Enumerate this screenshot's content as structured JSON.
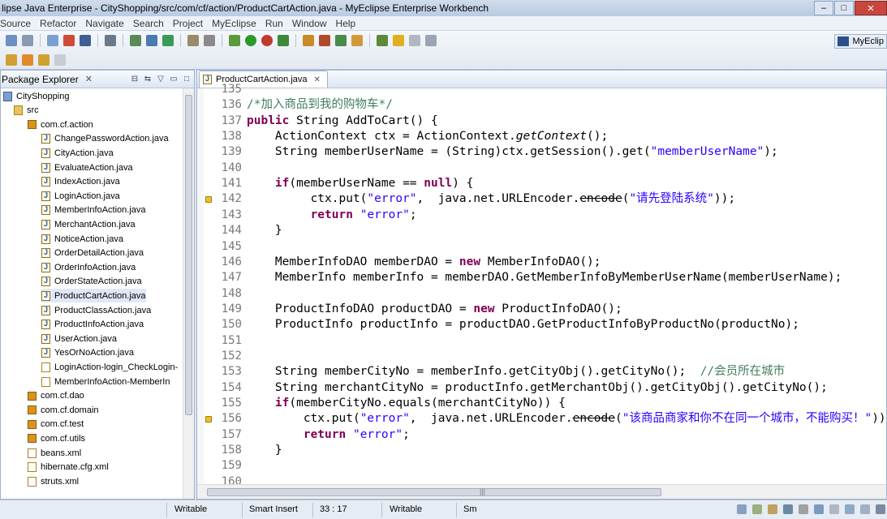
{
  "window": {
    "title": "lipse Java Enterprise - CityShopping/src/com/cf/action/ProductCartAction.java - MyEclipse Enterprise Workbench"
  },
  "menu": [
    "Source",
    "Refactor",
    "Navigate",
    "Search",
    "Project",
    "MyEclipse",
    "Run",
    "Window",
    "Help"
  ],
  "perspective": {
    "label": "MyEclip"
  },
  "package_explorer": {
    "title": "Package Explorer",
    "close": "✕",
    "tree": [
      {
        "label": "CityShopping",
        "icon": "project-icon"
      },
      {
        "label": "src",
        "icon": "source-folder-icon"
      },
      {
        "label": "com.cf.action",
        "icon": "package-icon"
      },
      {
        "label": "ChangePasswordAction.java",
        "icon": "java-file-icon"
      },
      {
        "label": "CityAction.java",
        "icon": "java-file-icon"
      },
      {
        "label": "EvaluateAction.java",
        "icon": "java-file-icon"
      },
      {
        "label": "IndexAction.java",
        "icon": "java-file-icon"
      },
      {
        "label": "LoginAction.java",
        "icon": "java-file-icon"
      },
      {
        "label": "MemberInfoAction.java",
        "icon": "java-file-icon"
      },
      {
        "label": "MerchantAction.java",
        "icon": "java-file-icon"
      },
      {
        "label": "NoticeAction.java",
        "icon": "java-file-icon"
      },
      {
        "label": "OrderDetailAction.java",
        "icon": "java-file-icon"
      },
      {
        "label": "OrderInfoAction.java",
        "icon": "java-file-icon"
      },
      {
        "label": "OrderStateAction.java",
        "icon": "java-file-icon"
      },
      {
        "label": "ProductCartAction.java",
        "icon": "java-file-icon"
      },
      {
        "label": "ProductClassAction.java",
        "icon": "java-file-icon"
      },
      {
        "label": "ProductInfoAction.java",
        "icon": "java-file-icon"
      },
      {
        "label": "UserAction.java",
        "icon": "java-file-icon"
      },
      {
        "label": "YesOrNoAction.java",
        "icon": "java-file-icon"
      },
      {
        "label": "LoginAction-login_CheckLogin-",
        "icon": "xml-file-icon"
      },
      {
        "label": "MemberInfoAction-MemberIn",
        "icon": "xml-file-icon"
      },
      {
        "label": "com.cf.dao",
        "icon": "package-icon"
      },
      {
        "label": "com.cf.domain",
        "icon": "package-icon"
      },
      {
        "label": "com.cf.test",
        "icon": "package-icon"
      },
      {
        "label": "com.cf.utils",
        "icon": "package-icon"
      },
      {
        "label": "beans.xml",
        "icon": "xml-file-icon"
      },
      {
        "label": "hibernate.cfg.xml",
        "icon": "xml-file-icon"
      },
      {
        "label": "struts.xml",
        "icon": "xml-file-icon"
      }
    ]
  },
  "editor": {
    "tab": {
      "label": "ProductCartAction.java",
      "close": "✕"
    },
    "line_numbers": [
      "135",
      "136",
      "137",
      "138",
      "139",
      "140",
      "141",
      "142",
      "143",
      "144",
      "145",
      "146",
      "147",
      "148",
      "149",
      "150",
      "151",
      "152",
      "153",
      "154",
      "155",
      "156",
      "157",
      "158",
      "159",
      "160"
    ],
    "code": [
      "",
      "/*加入商品到我的购物车*/",
      "public String AddToCart() {",
      "    ActionContext ctx = ActionContext.getContext();",
      "    String memberUserName = (String)ctx.getSession().get(\"memberUserName\");",
      "",
      "    if(memberUserName == null) {",
      "         ctx.put(\"error\",  java.net.URLEncoder.encode(\"请先登陆系统\"));",
      "         return \"error\";",
      "    }",
      "",
      "    MemberInfoDAO memberDAO = new MemberInfoDAO();",
      "    MemberInfo memberInfo = memberDAO.GetMemberInfoByMemberUserName(memberUserName);",
      "",
      "    ProductInfoDAO productDAO = new ProductInfoDAO();",
      "    ProductInfo productInfo = productDAO.GetProductInfoByProductNo(productNo);",
      "",
      "",
      "    String memberCityNo = memberInfo.getCityObj().getCityNo();  //会员所在城市",
      "    String merchantCityNo = productInfo.getMerchantObj().getCityObj().getCityNo();",
      "    if(memberCityNo.equals(merchantCityNo)) {",
      "        ctx.put(\"error\",  java.net.URLEncoder.encode(\"该商品商家和你不在同一个城市，不能购买！\"));",
      "        return \"error\";",
      "    }",
      "",
      ""
    ]
  },
  "status": {
    "writable1": "Writable",
    "insert_mode": "Smart Insert",
    "position": "33 : 17",
    "writable2": "Writable",
    "sm": "Sm"
  }
}
